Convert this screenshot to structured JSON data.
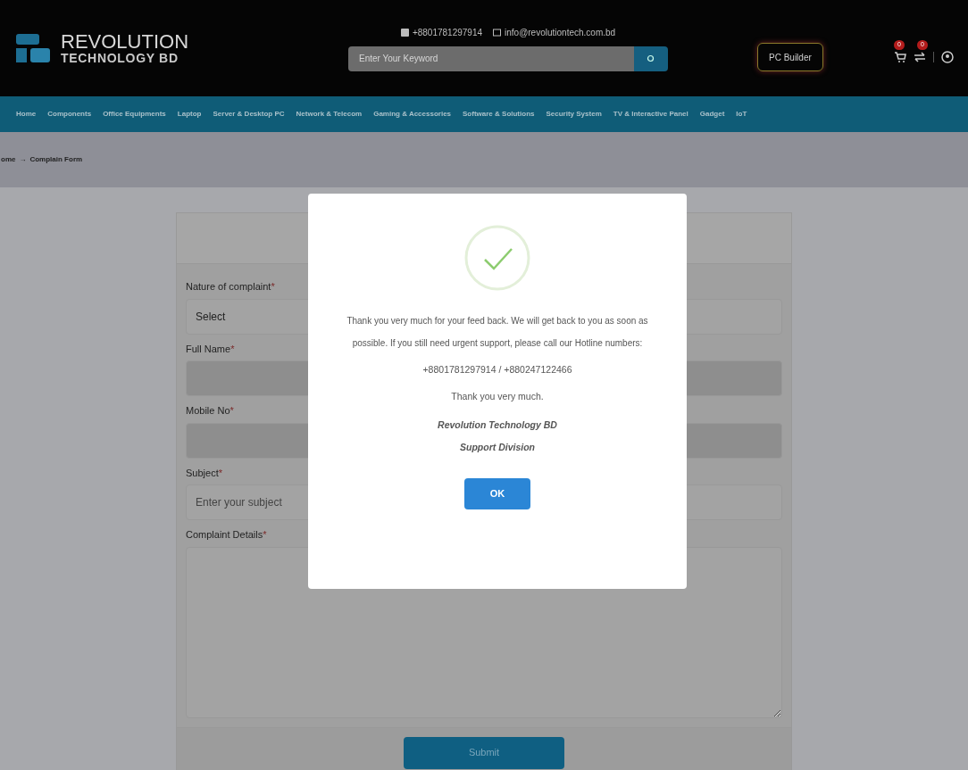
{
  "header": {
    "phone": "+8801781297914",
    "email": "info@revolutiontech.com.bd",
    "logo_title": "REVOLUTION",
    "logo_subtitle": "TECHNOLOGY BD",
    "search": {
      "placeholder": "Enter Your Keyword"
    },
    "pc_builder": "PC Builder",
    "cart_count": "0",
    "compare_count": "0"
  },
  "nav": [
    "Home",
    "Components",
    "Office Equipments",
    "Laptop",
    "Server & Desktop PC",
    "Network & Telecom",
    "Gaming & Accessories",
    "Software & Solutions",
    "Security System",
    "TV & Interactive Panel",
    "Gadget",
    "IoT"
  ],
  "breadcrumb": {
    "items": [
      "ome",
      "Complain Form"
    ],
    "separator": "→"
  },
  "form": {
    "fields": [
      {
        "label": "Nature of complaint",
        "mark": "*",
        "kind": "select",
        "value": "Select",
        "disabled": false
      },
      {
        "label": "Full Name",
        "mark": "*",
        "kind": "input",
        "disabled": true
      },
      {
        "label": "Mobile No",
        "mark": "*",
        "kind": "input",
        "disabled": true
      },
      {
        "label": "Subject",
        "mark": "*",
        "kind": "input",
        "placeholder": "Enter your subject",
        "disabled": false
      },
      {
        "label": "Complaint Details",
        "mark": "*",
        "kind": "textarea",
        "disabled": false
      }
    ],
    "submit": "Submit"
  },
  "modal": {
    "message": "Thank you very much for your feed back. We will get back to you as soon as possible. If you still need urgent support, please call our Hotline numbers:",
    "hotline": "+8801781297914 / +880247122466",
    "thanks": "Thank you very much.",
    "signature": [
      "Revolution Technology BD",
      "Support Division"
    ],
    "button": "OK"
  }
}
